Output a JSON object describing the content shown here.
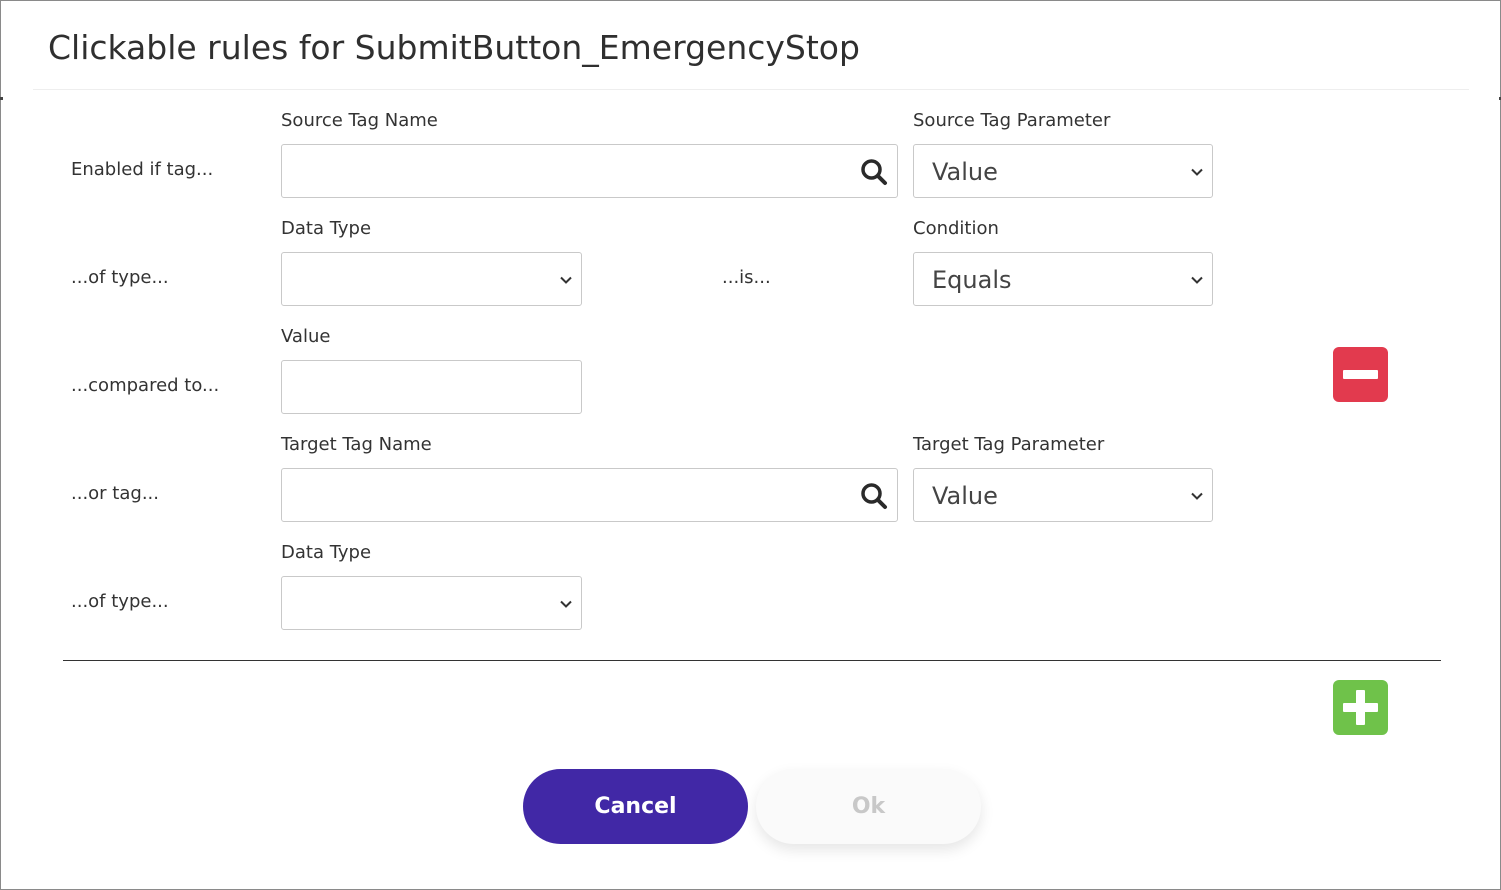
{
  "dialog": {
    "title": "Clickable rules for SubmitButton_EmergencyStop"
  },
  "rule": {
    "enabled_label": "Enabled if tag...",
    "source_tag_name_label": "Source Tag Name",
    "source_tag_name_value": "",
    "source_tag_parameter_label": "Source Tag Parameter",
    "source_tag_parameter_value": "Value",
    "of_type_label": "...of type...",
    "data_type_label": "Data Type",
    "data_type_value": "",
    "is_label": "...is...",
    "condition_label": "Condition",
    "condition_value": "Equals",
    "compared_to_label": "...compared to...",
    "value_label": "Value",
    "value_value": "",
    "or_tag_label": "...or tag...",
    "target_tag_name_label": "Target Tag Name",
    "target_tag_name_value": "",
    "target_tag_parameter_label": "Target Tag Parameter",
    "target_tag_parameter_value": "Value",
    "of_type_label_2": "...of type...",
    "target_data_type_label": "Data Type",
    "target_data_type_value": ""
  },
  "actions": {
    "cancel_label": "Cancel",
    "ok_label": "Ok"
  },
  "icons": {
    "search": "search-icon",
    "chevron": "chevron-down-icon",
    "remove": "minus-icon",
    "add": "plus-icon"
  },
  "colors": {
    "primary": "#4128a6",
    "remove": "#e23a4e",
    "add": "#6fc24a",
    "disabled_text": "#c8c8c8"
  }
}
